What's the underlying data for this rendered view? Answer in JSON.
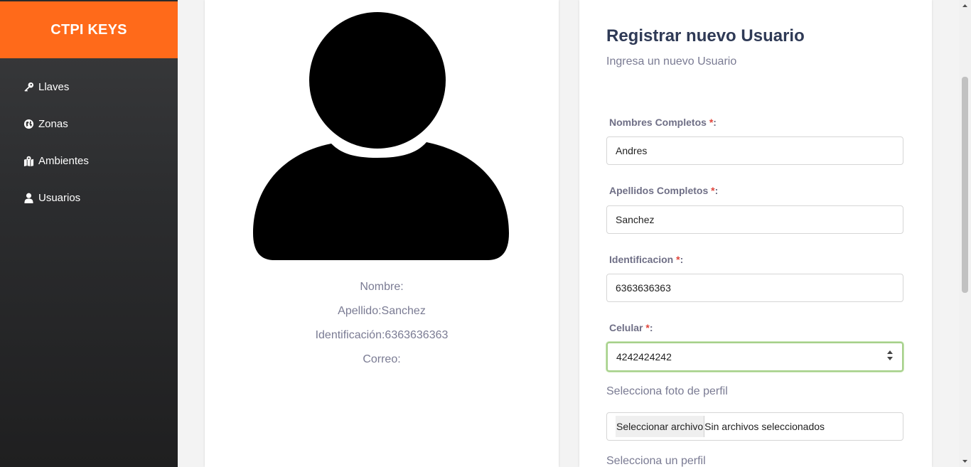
{
  "sidebar": {
    "brand": "CTPI KEYS",
    "items": [
      {
        "label": "Llaves",
        "icon": "key-icon"
      },
      {
        "label": "Zonas",
        "icon": "globe-icon"
      },
      {
        "label": "Ambientes",
        "icon": "map-marker-icon"
      },
      {
        "label": "Usuarios",
        "icon": "user-icon"
      }
    ]
  },
  "profile": {
    "nombre": "Nombre:",
    "apellido": "Apellido:Sanchez",
    "identificacion": "Identificación:6363636363",
    "correo": "Correo:"
  },
  "form": {
    "title": "Registrar nuevo Usuario",
    "subtitle": "Ingresa un nuevo Usuario",
    "required_mark": "*",
    "fields": {
      "nombres": {
        "label": "Nombres Completos ",
        "value": "Andres"
      },
      "apellidos": {
        "label": "Apellidos Completos ",
        "value": "Sanchez"
      },
      "identificacion": {
        "label": "Identificacion ",
        "value": "6363636363"
      },
      "celular": {
        "label": "Celular ",
        "value": "4242424242"
      }
    },
    "photo_label": "Selecciona foto de perfil",
    "file_button": "Seleccionar archivo",
    "file_status": "Sin archivos seleccionados",
    "profile_select_label": "Selecciona un perfil"
  },
  "colors": {
    "brand": "#ff6a1a",
    "title": "#2f3a56",
    "focus": "#a6d08b"
  }
}
